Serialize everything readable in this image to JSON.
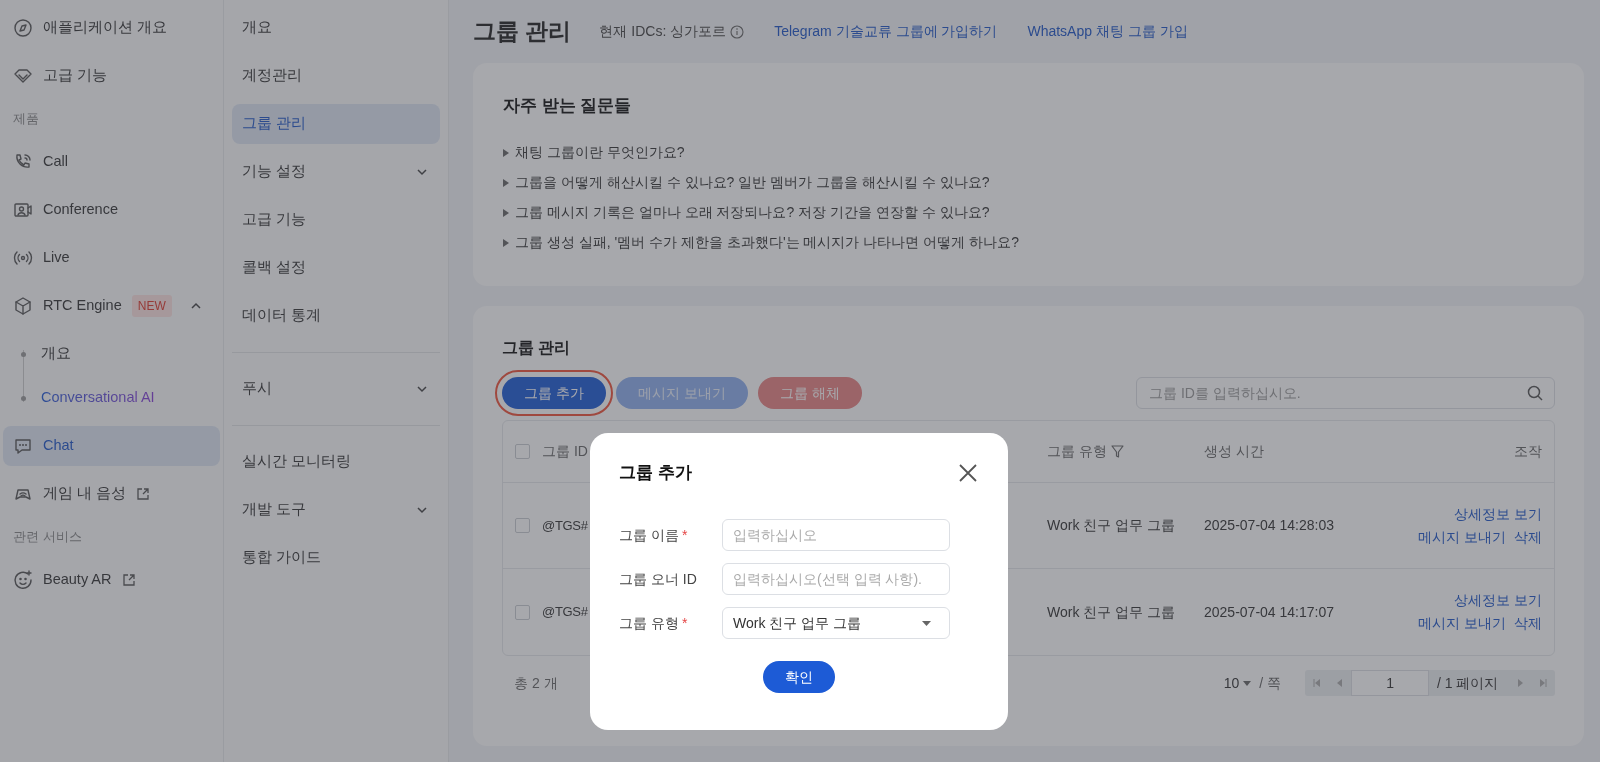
{
  "sidebar": {
    "items": [
      {
        "kind": "item",
        "label": "애플리케이션 개요",
        "selected": false,
        "external": false
      },
      {
        "kind": "item",
        "label": "고급 기능",
        "selected": false,
        "external": false
      },
      {
        "kind": "section",
        "label": "제품"
      },
      {
        "kind": "item",
        "label": "Call",
        "selected": false,
        "external": false
      },
      {
        "kind": "item",
        "label": "Conference",
        "selected": false,
        "external": false
      },
      {
        "kind": "item",
        "label": "Live",
        "selected": false,
        "external": false
      },
      {
        "kind": "group",
        "label": "RTC Engine",
        "badge": "NEW",
        "expanded": true,
        "children": [
          {
            "label": "개요",
            "accent": false
          },
          {
            "label": "Conversational AI",
            "accent": true
          }
        ]
      },
      {
        "kind": "item",
        "label": "Chat",
        "selected": true,
        "external": false
      },
      {
        "kind": "item",
        "label": "게임 내 음성",
        "selected": false,
        "external": true
      },
      {
        "kind": "section",
        "label": "관련 서비스"
      },
      {
        "kind": "item",
        "label": "Beauty AR",
        "selected": false,
        "external": true
      }
    ]
  },
  "subnav": {
    "items": [
      {
        "kind": "item",
        "label": "개요",
        "selected": false
      },
      {
        "kind": "item",
        "label": "계정관리",
        "selected": false
      },
      {
        "kind": "item",
        "label": "그룹 관리",
        "selected": true
      },
      {
        "kind": "group",
        "label": "기능 설정",
        "expanded": false
      },
      {
        "kind": "item",
        "label": "고급 기능",
        "selected": false
      },
      {
        "kind": "item",
        "label": "콜백 설정",
        "selected": false
      },
      {
        "kind": "item",
        "label": "데이터 통계",
        "selected": false
      },
      {
        "kind": "divider"
      },
      {
        "kind": "group",
        "label": "푸시",
        "expanded": false
      },
      {
        "kind": "divider"
      },
      {
        "kind": "item",
        "label": "실시간 모니터링",
        "selected": false
      },
      {
        "kind": "group",
        "label": "개발 도구",
        "expanded": false
      },
      {
        "kind": "item",
        "label": "통합 가이드",
        "selected": false
      }
    ]
  },
  "header": {
    "title": "그룹 관리",
    "idc": "현재 IDCs: 싱가포르",
    "links": [
      "Telegram 기술교류 그룹에 가입하기",
      "WhatsApp 채팅 그룹 가입"
    ]
  },
  "faq": {
    "title": "자주 받는 질문들",
    "items": [
      "채팅 그룹이란 무엇인가요?",
      "그룹을 어떻게 해산시킬 수 있나요? 일반 멤버가 그룹을 해산시킬 수 있나요?",
      "그룹 메시지 기록은 얼마나 오래 저장되나요? 저장 기간을 연장할 수 있나요?",
      "그룹 생성 실패, '멤버 수가 제한을 초과했다'는 메시지가 나타나면 어떻게 하나요?"
    ]
  },
  "group_panel": {
    "title": "그룹 관리",
    "buttons": [
      {
        "label": "그룹 추가",
        "kind": "primary",
        "disabled": false,
        "outlined": true
      },
      {
        "label": "메시지 보내기",
        "kind": "primary",
        "disabled": true,
        "outlined": false
      },
      {
        "label": "그룹 해체",
        "kind": "danger",
        "disabled": true,
        "outlined": false
      }
    ],
    "search": {
      "placeholder": "그룹 ID를 입력하십시오."
    },
    "table": {
      "select_all": false,
      "columns": [
        {
          "label": "그룹 ID"
        },
        {
          "label": "그룹 유형",
          "filter": true
        },
        {
          "label": "생성 시간",
          "filter": false
        },
        {
          "label": "조작",
          "filter": false
        }
      ],
      "rows": [
        {
          "checked": false,
          "group_id": "@TGS#",
          "type": "Work 친구 업무 그룹",
          "created": "2025-07-04 14:28:03",
          "actions": [
            "상세정보 보기",
            "메시지 보내기",
            "삭제"
          ]
        },
        {
          "checked": false,
          "group_id": "@TGS#",
          "type": "Work 친구 업무 그룹",
          "created": "2025-07-04 14:17:07",
          "actions": [
            "상세정보 보기",
            "메시지 보내기",
            "삭제"
          ]
        }
      ]
    },
    "footer": {
      "total": "총 2 개",
      "page_size": "10",
      "per": "/ 쪽",
      "page": "1",
      "pages": "/ 1 페이지"
    }
  },
  "modal": {
    "title": "그룹 추가",
    "fields": [
      {
        "kind": "input",
        "label": "그룹 이름",
        "required_mark": "*",
        "placeholder": "입력하십시오"
      },
      {
        "kind": "input",
        "label": "그룹 오너 ID",
        "placeholder": "입력하십시오(선택 입력 사항)."
      },
      {
        "kind": "select",
        "label": "그룹 유형",
        "required_mark": "*",
        "value": "Work 친구 업무 그룹"
      }
    ],
    "confirm": "확인"
  }
}
